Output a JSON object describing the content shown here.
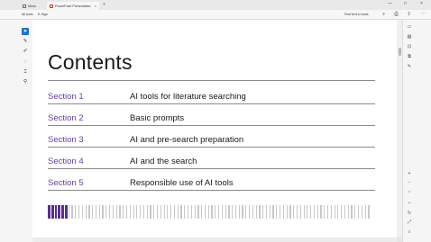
{
  "browser": {
    "tabs": [
      {
        "label": "Menu",
        "icon": "home-icon"
      },
      {
        "label": "PowerPoint Presentation",
        "icon": "pdf-document-icon",
        "close": "×"
      }
    ],
    "new_tab": "+",
    "window_controls": [
      "—",
      "□",
      "×"
    ]
  },
  "toolbar": {
    "all_tools": "All tools",
    "esign": "E-Sign",
    "find": "Find text or tools",
    "icons": [
      "search-icon",
      "print-icon",
      "share-icon",
      "more-icon"
    ]
  },
  "left_tools": [
    "select-cursor-icon",
    "comment-icon",
    "draw-icon",
    "highlight-icon",
    "text-select-icon",
    "stamp-icon"
  ],
  "slide": {
    "title": "Contents",
    "sections": [
      {
        "num": "Section 1",
        "topic": "AI tools for literature searching"
      },
      {
        "num": "Section 2",
        "topic": "Basic prompts"
      },
      {
        "num": "Section 3",
        "topic": "AI and pre-search preparation"
      },
      {
        "num": "Section 4",
        "topic": "AI and the search"
      },
      {
        "num": "Section 5",
        "topic": "Responsible use of AI tools"
      }
    ],
    "progress_indicator": {
      "filled": 6,
      "total": 95,
      "accent": "#5b2d91",
      "muted": "#c8c8c8"
    }
  },
  "right_tools": [
    "comments-panel-icon",
    "page-thumbnails-icon",
    "bookmarks-icon",
    "attachments-icon",
    "edit-icon"
  ],
  "right_nav": [
    "zoom-in-icon",
    "zoom-out-icon",
    "page-up-icon",
    "page-down-icon",
    "rotate-icon",
    "fit-page-icon",
    "zoom-icon"
  ],
  "colors": {
    "section": "#6a3ea1",
    "rule": "#8a8a8a",
    "accent": "#1f6fd1"
  }
}
